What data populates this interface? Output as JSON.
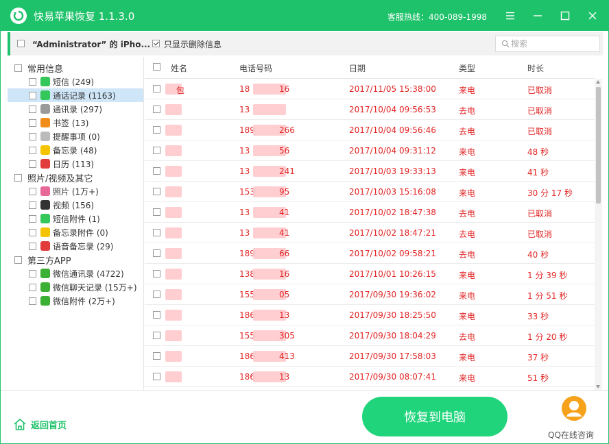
{
  "titlebar": {
    "title": "快易苹果恢复 1.1.3.0",
    "hotline": "客服热线：400-089-1998",
    "accent": "#1ec26a"
  },
  "devicebar": {
    "device_name": "“Administrator” 的 iPho...",
    "only_deleted_label": "只显示删除信息",
    "only_deleted_checked": true,
    "search_placeholder": "搜索"
  },
  "sidebar": {
    "categories": [
      {
        "label": "常用信息",
        "items": [
          {
            "label": "短信 (249)",
            "icon": "message-icon",
            "color": "#34c759"
          },
          {
            "label": "通话记录 (1163)",
            "icon": "phone-icon",
            "color": "#34c759",
            "selected": true
          },
          {
            "label": "通讯录 (297)",
            "icon": "contacts-icon",
            "color": "#9a9a9a"
          },
          {
            "label": "书签 (13)",
            "icon": "bookmark-icon",
            "color": "#f08c1a"
          },
          {
            "label": "提醒事项 (0)",
            "icon": "reminder-icon",
            "color": "#bbbbbb"
          },
          {
            "label": "备忘录 (48)",
            "icon": "notes-icon",
            "color": "#f5c400"
          },
          {
            "label": "日历 (113)",
            "icon": "calendar-icon",
            "color": "#e23b3b"
          }
        ]
      },
      {
        "label": "照片/视频及其它",
        "items": [
          {
            "label": "照片 (1万+)",
            "icon": "photos-icon",
            "color": "#e9689a"
          },
          {
            "label": "视频 (156)",
            "icon": "video-icon",
            "color": "#333333"
          },
          {
            "label": "短信附件 (1)",
            "icon": "attachment-icon",
            "color": "#34c759"
          },
          {
            "label": "备忘录附件 (0)",
            "icon": "notes-attachment-icon",
            "color": "#f5c400"
          },
          {
            "label": "语音备忘录 (29)",
            "icon": "voice-memo-icon",
            "color": "#e23b3b"
          }
        ]
      },
      {
        "label": "第三方APP",
        "items": [
          {
            "label": "微信通讯录 (4722)",
            "icon": "wechat-icon",
            "color": "#3cb034"
          },
          {
            "label": "微信聊天记录 (15万+)",
            "icon": "wechat-icon",
            "color": "#3cb034"
          },
          {
            "label": "微信附件 (2万+)",
            "icon": "wechat-icon",
            "color": "#3cb034"
          }
        ]
      }
    ]
  },
  "table": {
    "columns": [
      "姓名",
      "电话号码",
      "日期",
      "类型",
      "时长"
    ],
    "rows": [
      {
        "name": "包",
        "phone": "18",
        "phone_tail": "16",
        "date": "2017/11/05 15:38:00",
        "type": "来电",
        "duration": "已取消"
      },
      {
        "name": "",
        "phone": "13",
        "phone_tail": "",
        "date": "2017/10/04 09:56:53",
        "type": "去电",
        "duration": "已取消"
      },
      {
        "name": "",
        "phone": "189",
        "phone_tail": "266",
        "date": "2017/10/04 09:56:46",
        "type": "去电",
        "duration": "已取消"
      },
      {
        "name": "",
        "phone": "13",
        "phone_tail": "56",
        "date": "2017/10/04 09:31:12",
        "type": "来电",
        "duration": "48 秒"
      },
      {
        "name": "",
        "phone": "13",
        "phone_tail": "241",
        "date": "2017/10/03 19:33:13",
        "type": "来电",
        "duration": "41 秒"
      },
      {
        "name": "",
        "phone": "153",
        "phone_tail": "95",
        "date": "2017/10/03 15:16:08",
        "type": "来电",
        "duration": "30 分 17 秒"
      },
      {
        "name": "",
        "phone": "13",
        "phone_tail": "41",
        "date": "2017/10/02 18:47:38",
        "type": "去电",
        "duration": "已取消"
      },
      {
        "name": "",
        "phone": "13",
        "phone_tail": "41",
        "date": "2017/10/02 18:47:21",
        "type": "去电",
        "duration": "已取消"
      },
      {
        "name": "",
        "phone": "189",
        "phone_tail": "66",
        "date": "2017/10/02 09:58:21",
        "type": "去电",
        "duration": "40 秒"
      },
      {
        "name": "",
        "phone": "138",
        "phone_tail": "16",
        "date": "2017/10/01 10:26:15",
        "type": "来电",
        "duration": "1 分 39 秒"
      },
      {
        "name": "",
        "phone": "155",
        "phone_tail": "05",
        "date": "2017/09/30 19:36:02",
        "type": "来电",
        "duration": "1 分 51 秒"
      },
      {
        "name": "",
        "phone": "186",
        "phone_tail": "13",
        "date": "2017/09/30 18:25:50",
        "type": "来电",
        "duration": "33 秒"
      },
      {
        "name": "",
        "phone": "155",
        "phone_tail": "305",
        "date": "2017/09/30 18:04:29",
        "type": "去电",
        "duration": "1 分 20 秒"
      },
      {
        "name": "",
        "phone": "186",
        "phone_tail": "413",
        "date": "2017/09/30 17:58:03",
        "type": "来电",
        "duration": "37 秒"
      },
      {
        "name": "",
        "phone": "186",
        "phone_tail": "13",
        "date": "2017/09/30 08:07:41",
        "type": "来电",
        "duration": "51 秒"
      }
    ]
  },
  "footer": {
    "home_label": "返回首页",
    "recover_label": "恢复到电脑",
    "qq_label": "QQ在线咨询"
  }
}
